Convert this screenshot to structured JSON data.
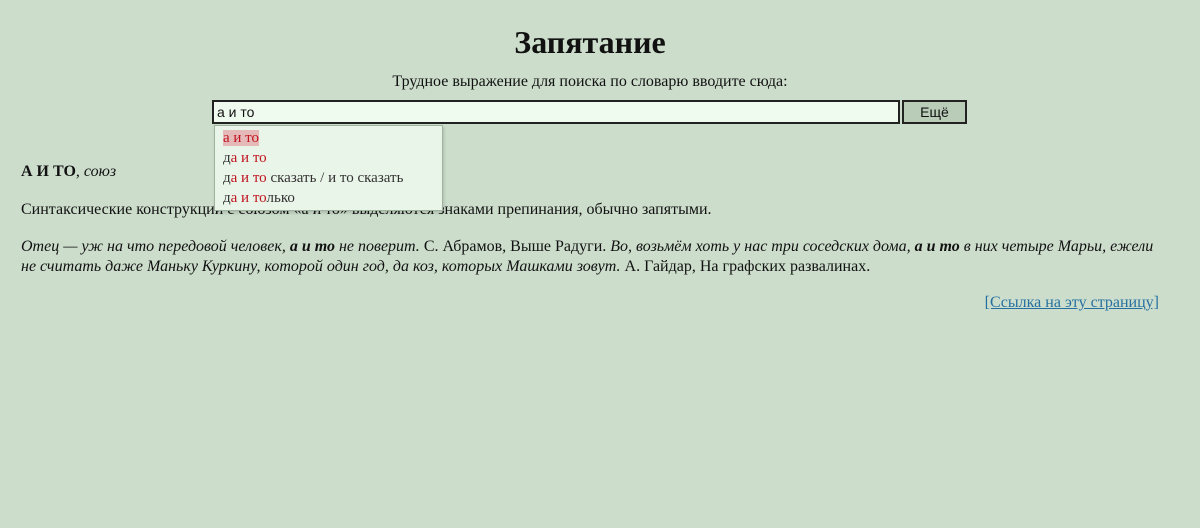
{
  "page": {
    "title": "Запятание",
    "prompt": "Трудное выражение для поиска по словарю вводите сюда:"
  },
  "search": {
    "value": "а и то",
    "button_label": "Ещё"
  },
  "suggestions": [
    {
      "prefix": "",
      "match": "а и то",
      "suffix": "",
      "selected": true
    },
    {
      "prefix": "д",
      "match": "а и то",
      "suffix": "",
      "selected": false
    },
    {
      "prefix": "д",
      "match": "а и то",
      "suffix": " сказать / и то сказать",
      "selected": false
    },
    {
      "prefix": "д",
      "match": "а и то",
      "suffix": "лько",
      "selected": false
    }
  ],
  "entry": {
    "headword": "А И ТО",
    "separator": ", ",
    "pos": "союз",
    "definition": "Синтаксические конструкции с союзом «а и то» выделяются знаками препинания, обычно запятыми.",
    "ex1_a": "Отец — уж на что передовой человек, ",
    "ex1_b": "а и то",
    "ex1_c": " не поверит.",
    "ex1_src": " С. Абрамов, Выше Радуги. ",
    "ex2_a": "Во, возьмём хоть у нас три соседских дома, ",
    "ex2_b": "а и то",
    "ex2_c": " в них четыре Марьи, ежели не считать даже Маньку Куркину, которой один год, да коз, которых Машками зовут.",
    "ex2_src": " А. Гайдар, На графских развалинах."
  },
  "footer": {
    "permalink_label": "[Ссылка на эту страницу]"
  },
  "colors": {
    "background": "#ccddcc",
    "highlight": "#c0141f",
    "link": "#2670a0"
  }
}
